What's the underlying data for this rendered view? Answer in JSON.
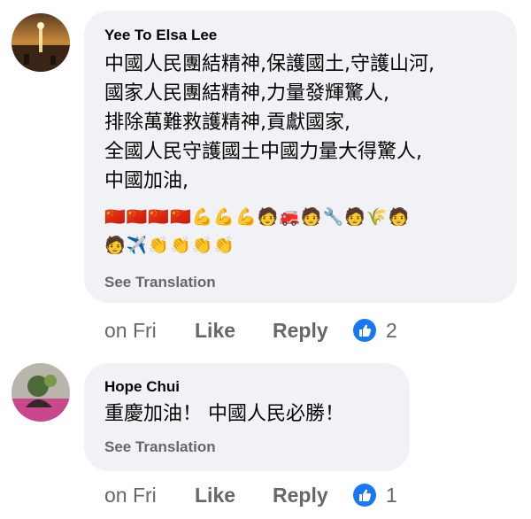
{
  "comments": [
    {
      "author": "Yee To Elsa Lee",
      "lines": [
        "中國人民團結精神,保護國土,守護山河,",
        "國家人民團結精神,力量發輝驚人,",
        "排除萬難救護精神,貢獻國家,",
        "全國人民守護國土中國力量大得驚人,",
        "中國加油,"
      ],
      "emoji_line_1": "🇨🇳🇨🇳🇨🇳🇨🇳💪💪💪🧑🚒🧑🔧🧑🌾🧑",
      "emoji_line_2": "🧑✈️👏👏👏👏",
      "see_translation": "See Translation",
      "time": "on Fri",
      "like_label": "Like",
      "reply_label": "Reply",
      "like_count": "2",
      "avatar_icon": "sunset-photo-avatar"
    },
    {
      "author": "Hope Chui",
      "lines": [
        "重慶加油！ 中國人民必勝！"
      ],
      "see_translation": "See Translation",
      "time": "on Fri",
      "like_label": "Like",
      "reply_label": "Reply",
      "like_count": "1",
      "avatar_icon": "person-photo-avatar"
    }
  ],
  "colors": {
    "bubble": "#f0f2f5",
    "secondary_text": "#65676b",
    "like_blue": "#1877f2"
  },
  "icons": {
    "like_badge": "thumbs-up-icon"
  }
}
